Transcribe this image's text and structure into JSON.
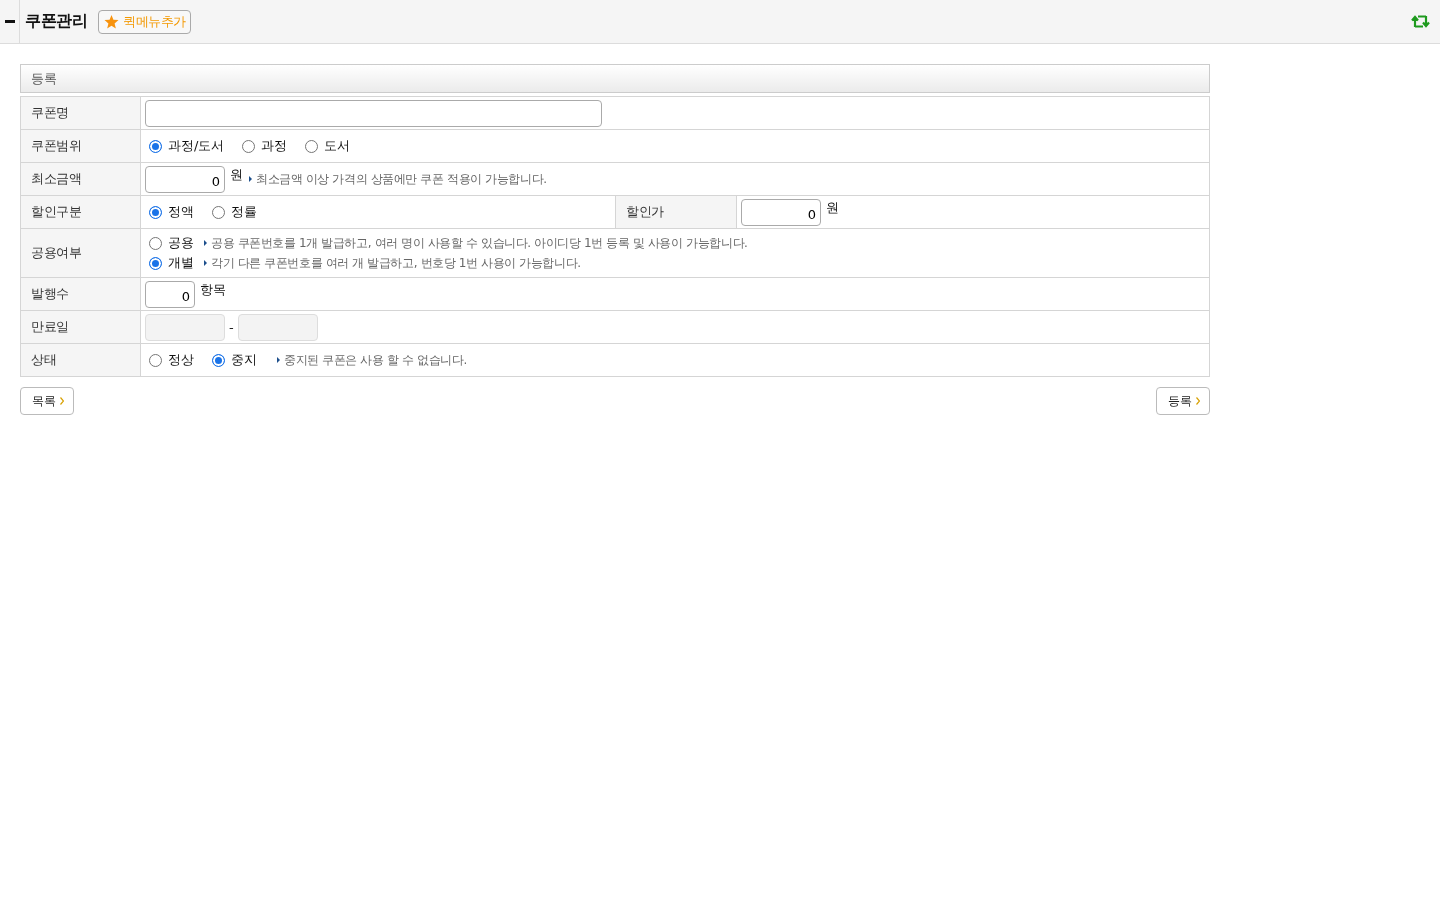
{
  "header": {
    "title": "쿠폰관리",
    "quick_menu_button": "퀵메뉴추가"
  },
  "section": {
    "title": "등록"
  },
  "form": {
    "rows": [
      {
        "kind": "text",
        "label": "쿠폰명"
      },
      {
        "kind": "radio",
        "label": "쿠폰범위",
        "options": [
          {
            "label": "과정/도서",
            "selected": true
          },
          {
            "label": "과정",
            "selected": false
          },
          {
            "label": "도서",
            "selected": false
          }
        ]
      },
      {
        "kind": "number",
        "label": "최소금액",
        "value": "0",
        "unit": "원",
        "note": "최소금액 이상 가격의 상품에만 쿠폰 적용이 가능합니다."
      },
      {
        "kind": "split",
        "label": "할인구분",
        "options": [
          {
            "label": "정액",
            "selected": true
          },
          {
            "label": "정률",
            "selected": false
          }
        ],
        "side_label": "할인가",
        "side_value": "0",
        "side_unit": "원"
      },
      {
        "kind": "radio_notes",
        "label": "공용여부",
        "options": [
          {
            "label": "공용",
            "selected": false,
            "note": "공용 쿠폰번호를 1개 발급하고, 여러 명이 사용할 수 있습니다. 아이디당 1번 등록 및 사용이 가능합니다."
          },
          {
            "label": "개별",
            "selected": true,
            "note": "각기 다른 쿠폰번호를 여러 개 발급하고, 번호당 1번 사용이 가능합니다."
          }
        ]
      },
      {
        "kind": "count",
        "label": "발행수",
        "value": "0",
        "unit": "항목"
      },
      {
        "kind": "date_range",
        "label": "만료일",
        "separator": "-",
        "fields": [
          {
            "disabled": true
          },
          {
            "disabled": true
          }
        ]
      },
      {
        "kind": "radio",
        "label": "상태",
        "options": [
          {
            "label": "정상",
            "selected": false
          },
          {
            "label": "중지",
            "selected": true
          }
        ],
        "note": "중지된 쿠폰은 사용 할 수 없습니다."
      }
    ]
  },
  "footer": {
    "left_button": "목록",
    "right_button": "등록"
  }
}
